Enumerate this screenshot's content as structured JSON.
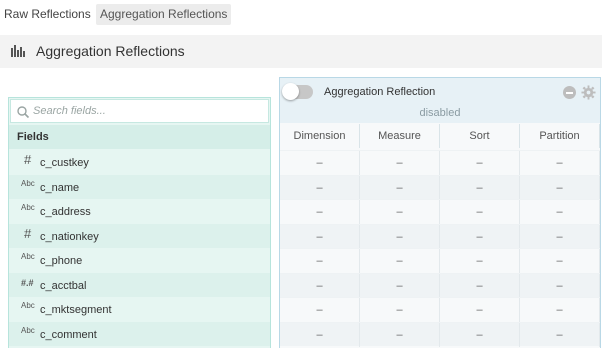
{
  "tabs": {
    "raw_label": "Raw Reflections",
    "agg_label": "Aggregation Reflections"
  },
  "section": {
    "title": "Aggregation Reflections",
    "icon": "bar-chart-icon"
  },
  "search": {
    "placeholder": "Search fields..."
  },
  "fields": {
    "header": "Fields",
    "items": [
      {
        "type": "#",
        "name": "c_custkey"
      },
      {
        "type": "Abc",
        "name": "c_name"
      },
      {
        "type": "Abc",
        "name": "c_address"
      },
      {
        "type": "#",
        "name": "c_nationkey"
      },
      {
        "type": "Abc",
        "name": "c_phone"
      },
      {
        "type": "#.#",
        "name": "c_acctbal"
      },
      {
        "type": "Abc",
        "name": "c_mktsegment"
      },
      {
        "type": "Abc",
        "name": "c_comment"
      }
    ]
  },
  "reflection": {
    "title": "Aggregation Reflection",
    "status": "disabled",
    "enabled": false,
    "columns": [
      "Dimension",
      "Measure",
      "Sort",
      "Partition"
    ],
    "empty_cell": "–"
  },
  "colors": {
    "fields_bg": "#e6f6f2",
    "fields_border": "#b7e4dc",
    "reflection_border": "#b9d8e6",
    "toggle_off": "#c7c7c7"
  }
}
